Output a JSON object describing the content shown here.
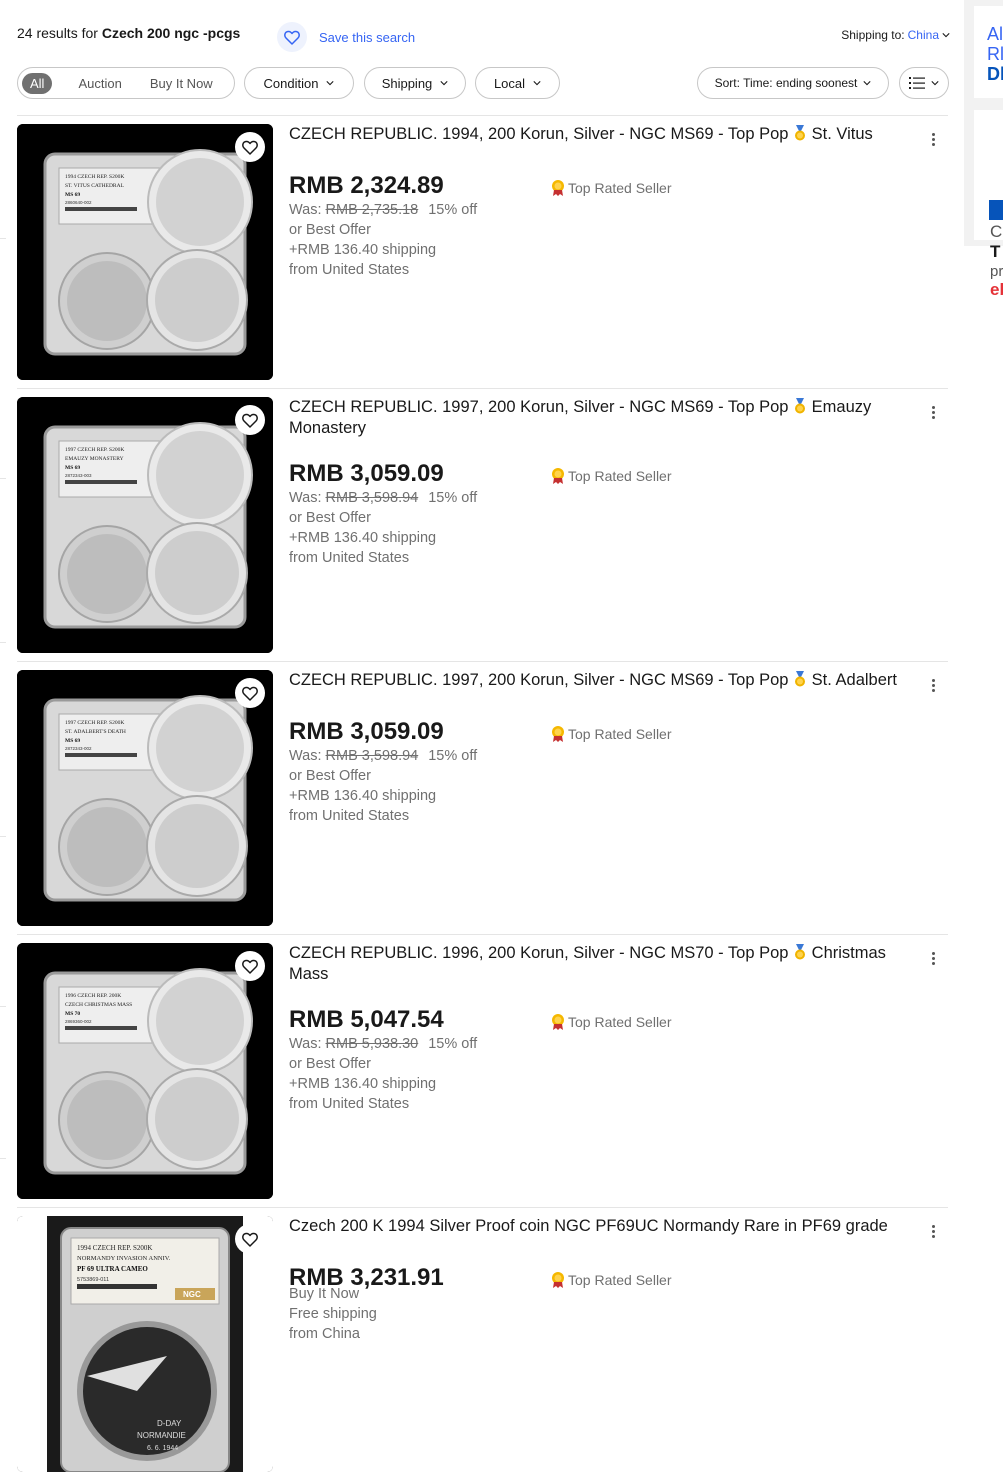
{
  "header": {
    "results_prefix": "24 results for ",
    "query": "Czech 200 ngc -pcgs",
    "save_search": "Save this search",
    "shipping_to_label": "Shipping to: ",
    "shipping_to_value": "China"
  },
  "filters": {
    "segments": [
      "All",
      "Auction",
      "Buy It Now"
    ],
    "dropdowns": [
      "Condition",
      "Shipping",
      "Local"
    ],
    "sort_label": "Sort: Time: ending soonest"
  },
  "listings": [
    {
      "title_a": "CZECH REPUBLIC. 1994, 200 Korun, Silver - NGC MS69 - Top Pop ",
      "title_b": " St. Vitus",
      "price": "RMB 2,324.89",
      "was_label": "Was: ",
      "was_price": "RMB 2,735.18",
      "discount": "15% off",
      "offer": "or Best Offer",
      "shipping": "+RMB 136.40 shipping",
      "origin": "from United States",
      "seller_badge": "Top Rated Seller",
      "slab": {
        "line1": "1994 CZECH REP. S200K",
        "line2": "ST. VITUS CATHEDRAL",
        "line3": "MS 69",
        "line4": "2860640-002"
      }
    },
    {
      "title_a": "CZECH REPUBLIC. 1997, 200 Korun, Silver - NGC MS69 - Top Pop ",
      "title_b": " Emauzy Monastery",
      "price": "RMB 3,059.09",
      "was_label": "Was: ",
      "was_price": "RMB 3,598.94",
      "discount": "15% off",
      "offer": "or Best Offer",
      "shipping": "+RMB 136.40 shipping",
      "origin": "from United States",
      "seller_badge": "Top Rated Seller",
      "slab": {
        "line1": "1997 CZECH REP. S200K",
        "line2": "EMAUZY MONASTERY",
        "line3": "MS 69",
        "line4": "2872343-003"
      }
    },
    {
      "title_a": "CZECH REPUBLIC. 1997, 200 Korun, Silver - NGC MS69 - Top Pop ",
      "title_b": " St. Adalbert",
      "price": "RMB 3,059.09",
      "was_label": "Was: ",
      "was_price": "RMB 3,598.94",
      "discount": "15% off",
      "offer": "or Best Offer",
      "shipping": "+RMB 136.40 shipping",
      "origin": "from United States",
      "seller_badge": "Top Rated Seller",
      "slab": {
        "line1": "1997 CZECH REP. S200K",
        "line2": "ST. ADALBERT'S DEATH",
        "line3": "MS 69",
        "line4": "2872343-002"
      }
    },
    {
      "title_a": "CZECH REPUBLIC. 1996, 200 Korun, Silver - NGC MS70 - Top Pop ",
      "title_b": " Christmas Mass",
      "price": "RMB 5,047.54",
      "was_label": "Was: ",
      "was_price": "RMB 5,938.30",
      "discount": "15% off",
      "offer": "or Best Offer",
      "shipping": "+RMB 136.40 shipping",
      "origin": "from United States",
      "seller_badge": "Top Rated Seller",
      "slab": {
        "line1": "1996 CZECH REP. 200K",
        "line2": "CZECH CHRISTMAS MASS",
        "line3": "MS 70",
        "line4": "2869360-002"
      }
    },
    {
      "title_a": "Czech 200 K 1994 Silver Proof coin NGC PF69UC Normandy Rare in PF69 grade",
      "title_b": "",
      "price": "RMB 3,231.91",
      "offer": "Buy It Now",
      "shipping": "Free shipping",
      "origin": "from China",
      "seller_badge": "Top Rated Seller",
      "slab": {
        "line1": "1994 CZECH REP. S200K",
        "line2": "NORMANDY INVASION ANNIV.",
        "line3": "PF 69 ULTRA CAMEO",
        "line4": "5753869-011",
        "brand": "NGC",
        "coin_text1": "D-DAY",
        "coin_text2": "NORMANDIE",
        "coin_text3": "6. 6. 1944"
      }
    }
  ],
  "side_ads": {
    "ad1_lines": [
      "Al",
      "Rl",
      "Dl"
    ],
    "ad2_lines": [
      "C",
      "T",
      "pr",
      "eb"
    ]
  },
  "colors": {
    "link": "#3665f3",
    "text": "#191919",
    "muted": "#707070",
    "border": "#c7c7c7",
    "active_segment": "#707070"
  }
}
